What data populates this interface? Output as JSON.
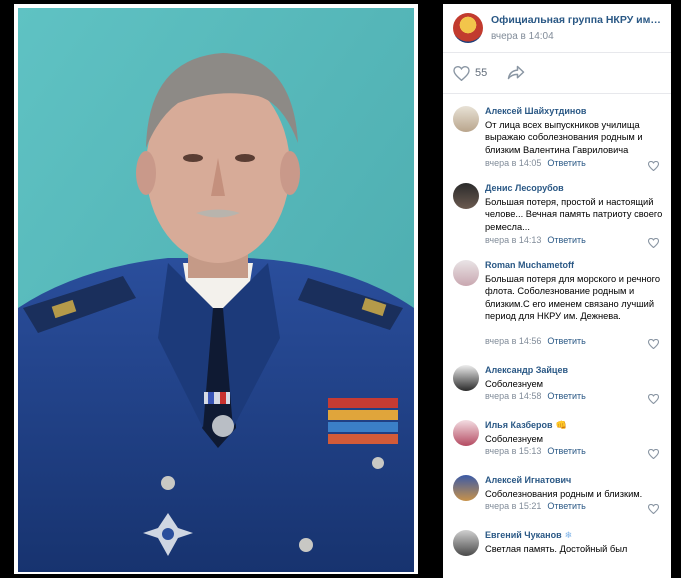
{
  "post": {
    "group_name": "Официальная группа НКРУ им. С.И.",
    "time": "вчера в 14:04",
    "likes": "55"
  },
  "comments": [
    {
      "author": "Алексей Шайхутдинов",
      "text": "От лица всех выпускников училища выражаю соболезнования родным и близким Валентина Гавриловича",
      "time": "вчера в 14:05",
      "reply": "Ответить"
    },
    {
      "author": "Денис Лесорубов",
      "text": "Большая потеря, простой и настоящий челове... Вечная память патриоту своего ремесла...",
      "time": "вчера в 14:13",
      "reply": "Ответить"
    },
    {
      "author": "Roman Muchametoff",
      "text": "Большая потеря для морского и речного флота. Соболезнование родным и близким.С его именем связано лучший период для НКРУ им. Дежнева.",
      "time": "вчера в 14:56",
      "reply": "Ответить"
    },
    {
      "author": "Александр Зайцев",
      "text": "Соболезнуем",
      "time": "вчера в 14:58",
      "reply": "Ответить"
    },
    {
      "author": "Илья Казберов",
      "emoji": "👊",
      "text": "Соболезнуем",
      "time": "вчера в 15:13",
      "reply": "Ответить"
    },
    {
      "author": "Алексей Игнатович",
      "text": "Соболезнования родным и близким.",
      "time": "вчера в 15:21",
      "reply": "Ответить"
    },
    {
      "author": "Евгений Чуканов",
      "emoji": "❄",
      "text": "Светлая память. Достойный был",
      "time": "",
      "reply": ""
    }
  ],
  "colors": {
    "link": "#2a5885",
    "meta": "#818c99",
    "photo_bg": "#58b9bb",
    "uniform": "#1f3f86"
  }
}
